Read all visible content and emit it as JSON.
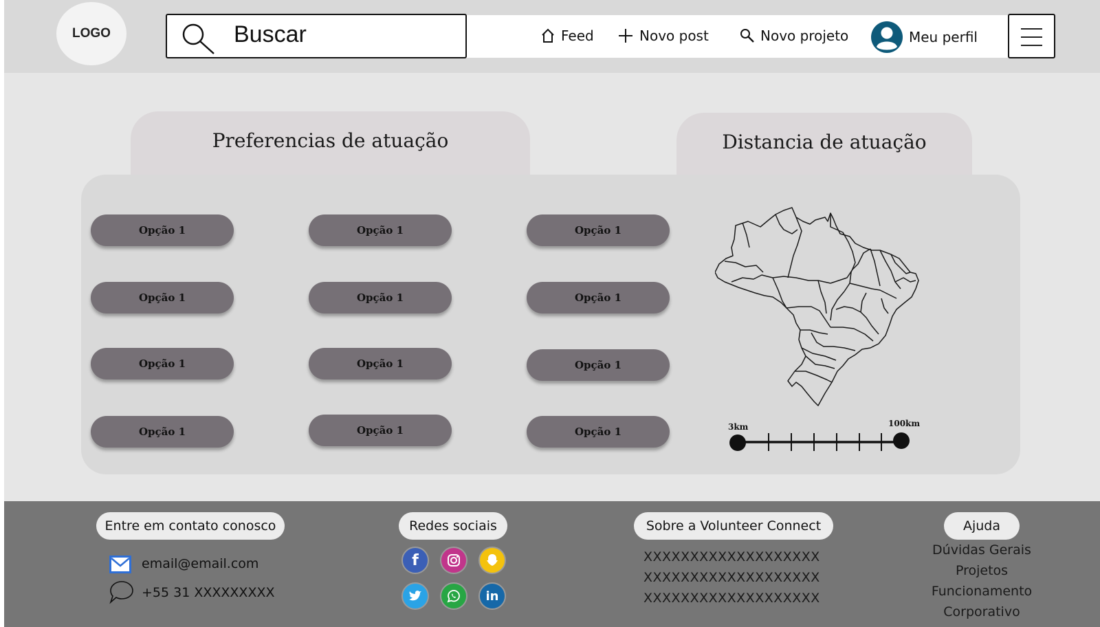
{
  "header": {
    "logo": "LOGO",
    "search_placeholder": "Buscar",
    "nav": {
      "feed": "Feed",
      "new_post": "Novo post",
      "new_project": "Novo projeto",
      "profile": "Meu perfil"
    }
  },
  "main": {
    "preferences_title": "Preferencias de atuação",
    "distance_title": "Distancia de atuação",
    "options": [
      "Opção 1",
      "Opção 1",
      "Opção 1",
      "Opção 1",
      "Opção 1",
      "Opção 1",
      "Opção 1",
      "Opção 1",
      "Opção 1",
      "Opção 1",
      "Opção 1",
      "Opção 1"
    ],
    "slider": {
      "min_label": "3km",
      "max_label": "100km"
    }
  },
  "footer": {
    "contact": {
      "title": "Entre em contato conosco",
      "email": "email@email.com",
      "phone": "+55 31 XXXXXXXXX"
    },
    "social": {
      "title": "Redes sociais",
      "icons": [
        "facebook-icon",
        "instagram-icon",
        "snapchat-icon",
        "twitter-icon",
        "whatsapp-icon",
        "linkedin-icon"
      ]
    },
    "about": {
      "title": "Sobre a Volunteer Connect",
      "lines": [
        "XXXXXXXXXXXXXXXXXXX",
        "XXXXXXXXXXXXXXXXXXX",
        "XXXXXXXXXXXXXXXXXXX"
      ]
    },
    "help": {
      "title": "Ajuda",
      "links": [
        "Dúvidas Gerais",
        "Projetos",
        "Funcionamento",
        "Corporativo"
      ]
    }
  },
  "colors": {
    "header_bg": "#d9d9d9",
    "main_bg": "#e6e6e6",
    "pill": "#767076",
    "footer_bg": "#767676",
    "profile_avatar": "#0e5a7a"
  }
}
